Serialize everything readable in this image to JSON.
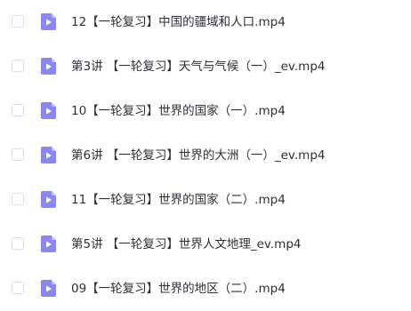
{
  "files": [
    {
      "name": "12【一轮复习】中国的疆域和人口.mp4",
      "type_icon": "video-file-icon"
    },
    {
      "name": "第3讲 【一轮复习】天气与气候（一）_ev.mp4",
      "type_icon": "video-file-icon"
    },
    {
      "name": "10【一轮复习】世界的国家（一）.mp4",
      "type_icon": "video-file-icon"
    },
    {
      "name": "第6讲 【一轮复习】世界的大洲（一）_ev.mp4",
      "type_icon": "video-file-icon"
    },
    {
      "name": "11【一轮复习】世界的国家（二）.mp4",
      "type_icon": "video-file-icon"
    },
    {
      "name": "第5讲 【一轮复习】世界人文地理_ev.mp4",
      "type_icon": "video-file-icon"
    },
    {
      "name": "09【一轮复习】世界的地区（二）.mp4",
      "type_icon": "video-file-icon"
    }
  ],
  "colors": {
    "icon_fill": "#8a86f2",
    "icon_fold": "#c4c1fa",
    "text": "#2b2f36",
    "checkbox_border": "#d9dce2"
  }
}
